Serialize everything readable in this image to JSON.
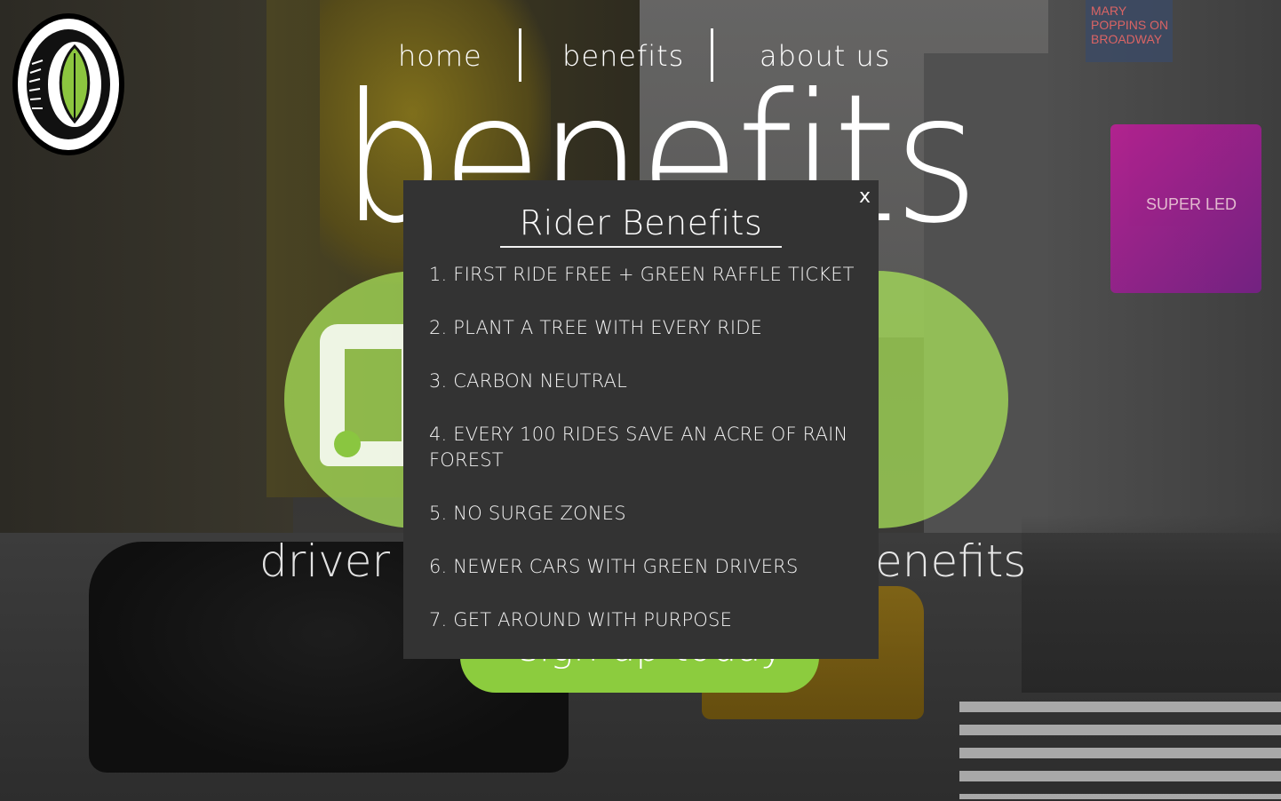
{
  "nav": {
    "items": [
      {
        "label": "home"
      },
      {
        "label": "benefits"
      },
      {
        "label": "about us"
      }
    ]
  },
  "page": {
    "title": "benefits",
    "driver_label": "driver b",
    "rider_label": "enefits",
    "signup_label": "sign up today"
  },
  "background": {
    "signs": {
      "super_led": "SUPER LED",
      "poppins": "MARY POPPINS ON BROADWAY"
    }
  },
  "modal": {
    "title": "Rider Benefits",
    "close_label": "x",
    "items": [
      "1. FIRST RIDE FREE + GREEN RAFFLE TICKET",
      "2. PLANT A TREE WITH EVERY RIDE",
      "3. CARBON NEUTRAL",
      "4. EVERY 100 RIDES SAVE AN ACRE OF RAIN FOREST",
      "5. NO SURGE ZONES",
      "6. NEWER CARS WITH GREEN DRIVERS",
      "7. GET AROUND WITH PURPOSE"
    ]
  },
  "colors": {
    "accent_green": "#8ccc3e",
    "modal_bg": "#333333",
    "text": "#ffffff"
  },
  "icons": {
    "logo": "tire-leaf-logo-icon",
    "driver": "car-icon"
  }
}
